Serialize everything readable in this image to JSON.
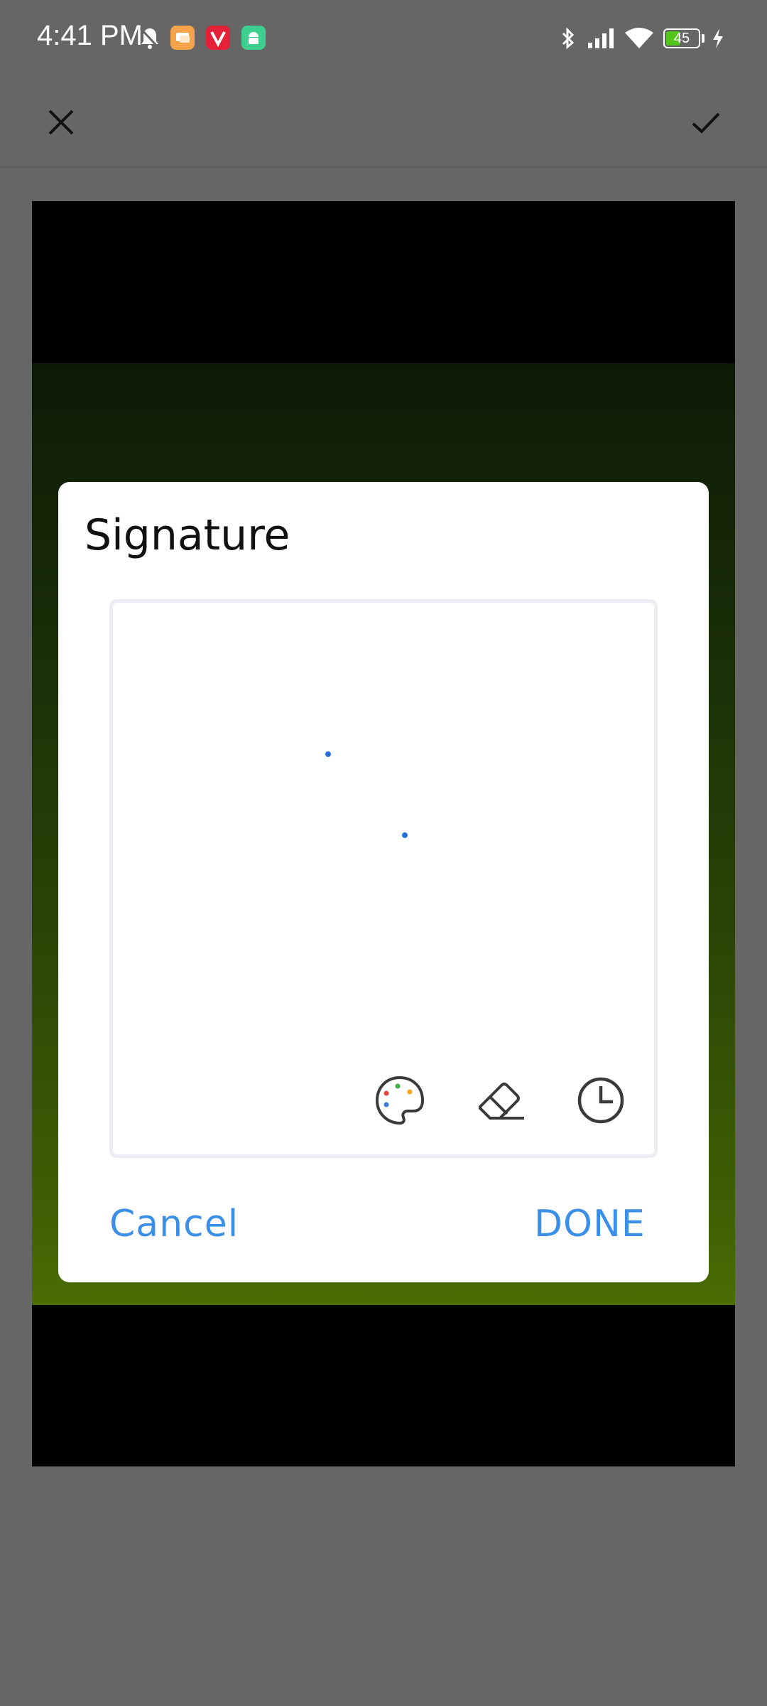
{
  "status_bar": {
    "time": "4:41 PM",
    "battery_level": "45",
    "battery_fraction": 0.45,
    "icons": [
      "mute-bell-icon",
      "chat-app-icon",
      "vivaldi-app-icon",
      "android-app-icon",
      "bluetooth-icon",
      "signal-icon",
      "wifi-icon",
      "battery-icon",
      "charging-icon"
    ]
  },
  "toolbar": {
    "close_icon": "close-icon",
    "confirm_icon": "check-icon"
  },
  "dialog": {
    "title": "Signature",
    "cancel_label": "Cancel",
    "done_label": "DONE",
    "tools": [
      "palette-icon",
      "eraser-icon",
      "history-clock-icon"
    ]
  },
  "colors": {
    "accent": "#3b8fe8",
    "stroke": "#2a6fd6",
    "scrim": "#666666"
  }
}
